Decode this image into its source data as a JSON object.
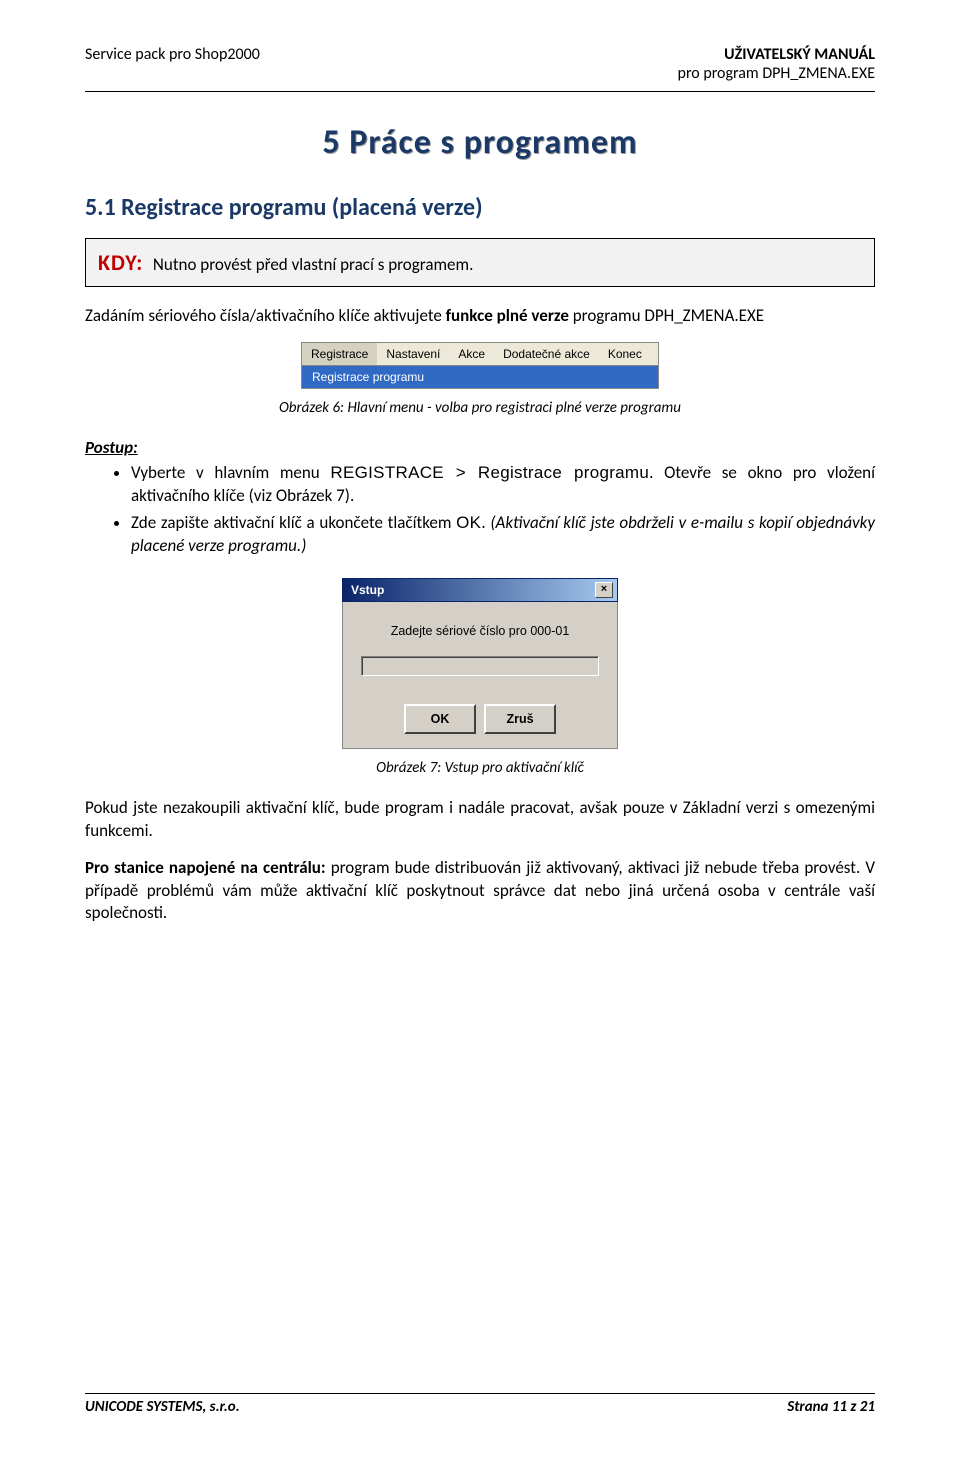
{
  "header": {
    "left": "Service pack pro Shop2000",
    "right_bold": "UŽIVATELSKÝ MANUÁL",
    "right_sub": "pro program DPH_ZMENA.EXE"
  },
  "chapter_title": "5 Práce s programem",
  "section_title": "5.1 Registrace programu (placená verze)",
  "kdy": {
    "label": "KDY:",
    "text": "Nutno provést před vlastní prací s programem."
  },
  "intro": {
    "pre": "Zadáním sériového čísla/aktivačního klíče aktivujete ",
    "bold": "funkce plné verze",
    "post": " programu DPH_ZMENA.EXE"
  },
  "menu_shot": {
    "items": [
      "Registrace",
      "Nastavení",
      "Akce",
      "Dodatečné akce",
      "Konec"
    ],
    "dropdown": "Registrace programu",
    "caption": "Obrázek 6: Hlavní menu - volba pro registraci plné verze programu"
  },
  "postup_label": "Postup:",
  "steps": {
    "s1": {
      "pre": "Vyberte v hlavním menu ",
      "mono": "REGISTRACE > Registrace programu",
      "post": ". Otevře se okno pro vložení aktivačního klíče (viz Obrázek 7)."
    },
    "s2": {
      "pre": "Zde zapište aktivační klíč a ukončete tlačítkem ",
      "mono": "OK",
      "post_italic": " (Aktivační klíč jste obdrželi v e-mailu s kopií objednávky placené verze programu.)",
      "dot": ". "
    }
  },
  "dialog": {
    "title": "Vstup",
    "close": "×",
    "prompt": "Zadejte sériové číslo pro 000-01",
    "ok": "OK",
    "cancel": "Zruš",
    "caption": "Obrázek 7: Vstup pro aktivační klíč"
  },
  "para1": "Pokud jste nezakoupili aktivační klíč, bude program i nadále pracovat, avšak pouze v Základní verzi s omezenými funkcemi.",
  "para2": {
    "bold": "Pro stanice napojené na centrálu:",
    "rest": " program bude distribuován již aktivovaný, aktivaci již nebude třeba provést. V případě problémů vám může aktivační klíč poskytnout správce dat nebo jiná určená osoba v centrále vaší společnosti."
  },
  "footer": {
    "left": "UNICODE SYSTEMS, s.r.o.",
    "right": "Strana 11 z 21"
  }
}
